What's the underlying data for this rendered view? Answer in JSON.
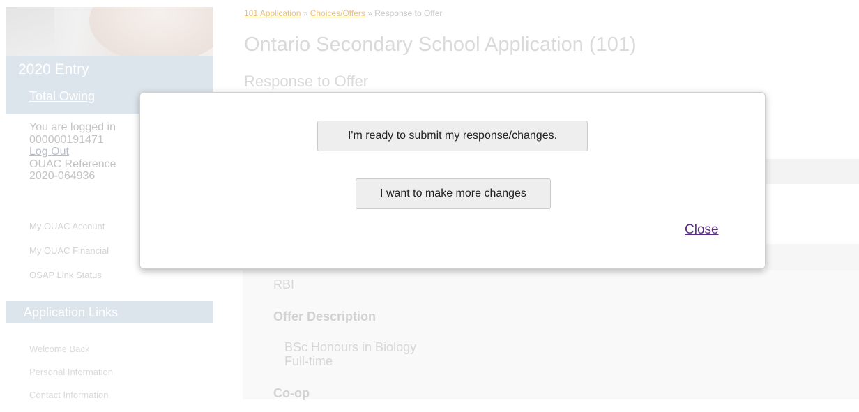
{
  "sidebar": {
    "entry_title": "2020 Entry",
    "total_owing": "Total Owing",
    "login_line": "You are logged in",
    "login_id": "000000191471",
    "logout": "Log Out",
    "ouac_reference_label": "OUAC Reference",
    "ouac_reference_value": "2020-064936",
    "account_links": [
      "My OUAC Account",
      "My OUAC Financial",
      "OSAP Link Status"
    ],
    "application_links_header": "Application Links",
    "application_links": [
      "Welcome Back",
      "Personal Information",
      "Contact Information"
    ]
  },
  "breadcrumb": {
    "link1": "101 Application",
    "sep1": " » ",
    "link2": "Choices/Offers",
    "sep2": " » ",
    "current": "Response to Offer"
  },
  "page": {
    "title": "Ontario Secondary School Application (101)",
    "subtitle": "Response to Offer"
  },
  "offer": {
    "code": "RBI",
    "description_label": "Offer Description",
    "description_line1": "BSc Honours in Biology",
    "description_line2": "Full-time",
    "coop_label": "Co-op"
  },
  "modal": {
    "submit_button": "I'm ready to submit my response/changes.",
    "changes_button": "I want to make more changes",
    "close_link": "Close"
  },
  "colors": {
    "modal_link": "#5b2c87",
    "sidebar_header_bg": "#dde5ec"
  }
}
